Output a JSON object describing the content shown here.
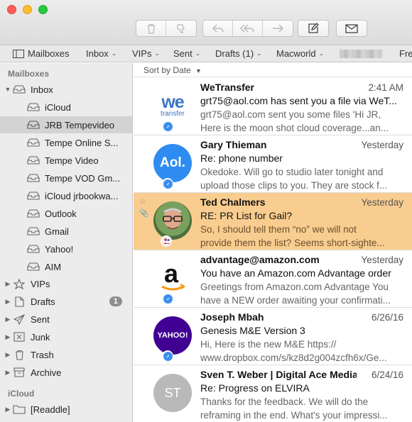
{
  "favbar": {
    "mailboxes": "Mailboxes",
    "inbox": "Inbox",
    "vips": "VIPs",
    "sent": "Sent",
    "drafts": "Drafts (1)",
    "macworld": "Macworld",
    "fre": "Fre"
  },
  "sidebar": {
    "section_mailboxes": "Mailboxes",
    "section_icloud": "iCloud",
    "inbox": "Inbox",
    "accounts": [
      "iCloud",
      "JRB Tempevideo",
      "Tempe Online S...",
      "Tempe Video",
      "Tempe VOD Gm...",
      "iCloud jrbookwa...",
      "Outlook",
      "Gmail",
      "Yahoo!",
      "AIM"
    ],
    "vips": "VIPs",
    "drafts": "Drafts",
    "drafts_count": "1",
    "sent": "Sent",
    "junk": "Junk",
    "trash": "Trash",
    "archive": "Archive",
    "readdle": "[Readdle]"
  },
  "list": {
    "sort_label": "Sort by Date",
    "messages": [
      {
        "sender": "WeTransfer",
        "date": "2:41 AM",
        "subject": "grt75@aol.com has sent you a file via WeT...",
        "preview1": "grt75@aol.com sent you some files 'Hi JR,",
        "preview2": "Here is the moon shot cloud coverage...an..."
      },
      {
        "sender": "Gary Thieman",
        "date": "Yesterday",
        "subject": "Re: phone number",
        "preview1": "Okedoke. Will go to studio later tonight and",
        "preview2": "upload those clips to you. They are stock f..."
      },
      {
        "sender": "Ted Chalmers",
        "date": "Yesterday",
        "subject": "RE: PR List for Gail?",
        "preview1": "So, I should tell them “no” we will not",
        "preview2": "provide them the list?  Seems short-sighte..."
      },
      {
        "sender": "advantage@amazon.com",
        "date": "Yesterday",
        "subject": "You have an Amazon.com Advantage order",
        "preview1": "Greetings from Amazon.com Advantage You",
        "preview2": "have a NEW order awaiting your confirmati..."
      },
      {
        "sender": "Joseph Mbah",
        "date": "6/26/16",
        "subject": "Genesis M&E Version 3",
        "preview1": "Hi, Here is the new M&E https://",
        "preview2": "www.dropbox.com/s/kz8d2g004zcfh6x/Ge..."
      },
      {
        "sender": "Sven T. Weber | Digital Ace Media",
        "date": "6/24/16",
        "subject": "Re: Progress on ELVIRA",
        "preview1": "Thanks for the feedback. We will do the",
        "preview2": "reframing in the end. What's your impressi..."
      }
    ],
    "avatar_labels": {
      "wetransfer_top": "we",
      "wetransfer_bottom": "transfer",
      "aol": "Aol.",
      "yahoo": "YAHOO!",
      "sven": "ST"
    }
  },
  "colors": {
    "selected_row": "#f9cd8f",
    "aol_blue": "#2e8cf0",
    "yahoo_purple": "#410093",
    "sidebar_bg": "#ececec"
  }
}
